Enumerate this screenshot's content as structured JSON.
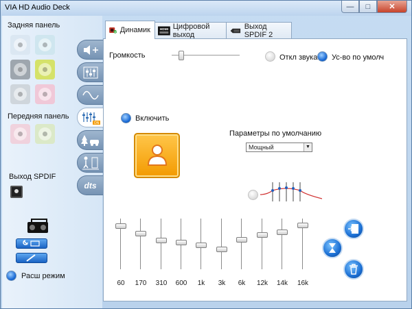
{
  "window": {
    "title": "VIA HD Audio Deck"
  },
  "colors": {
    "accent": "#1869d6",
    "orange": "#f39a00",
    "window_bg": "#c6dcf2",
    "pink_jack": "#f0c8d8",
    "lime_jack": "#d5e26a"
  },
  "left": {
    "rear_panel_label": "Задняя панель",
    "front_panel_label": "Передняя панель",
    "spdif_label": "Выход SPDIF",
    "extended_mode_label": "Расш режим",
    "rear_jacks": [
      "blue-light",
      "teal-light",
      "grey",
      "lime",
      "grey-light",
      "pink-light"
    ],
    "front_jacks": [
      "pink-light",
      "lime-light"
    ],
    "side_tabs": [
      "speaker-volume-icon",
      "mixer-icon",
      "waveform-icon",
      "equalizer-icon",
      "environment-icon",
      "room-correction-icon",
      "dts-icon"
    ],
    "side_tab_dts_text": "dts",
    "side_tab_eq_badge": "ON"
  },
  "tabs": [
    {
      "label": "Динамик",
      "icon": "speaker-icon"
    },
    {
      "label": "Цифровой выход",
      "icon": "hdmi-icon",
      "badge": "HDMI"
    },
    {
      "label": "Выход SPDIF 2",
      "icon": "spdif-device-icon"
    }
  ],
  "content": {
    "volume_label": "Громкость",
    "volume_level": 0.1,
    "mute_label": "Откл звука",
    "mute_selected": false,
    "default_device_label": "Ус-во по умолч",
    "default_device_selected": true,
    "enable_label": "Включить",
    "enable_selected": true,
    "defaults_label": "Параметры по умолчанию",
    "preset_value": "Мощный",
    "eq_bands": [
      {
        "freq": "60",
        "level": 0.85
      },
      {
        "freq": "170",
        "level": 0.7
      },
      {
        "freq": "310",
        "level": 0.57
      },
      {
        "freq": "600",
        "level": 0.53
      },
      {
        "freq": "1k",
        "level": 0.47
      },
      {
        "freq": "3k",
        "level": 0.39
      },
      {
        "freq": "6k",
        "level": 0.58
      },
      {
        "freq": "12k",
        "level": 0.68
      },
      {
        "freq": "14k",
        "level": 0.73
      },
      {
        "freq": "16k",
        "level": 0.86
      }
    ],
    "round_buttons": [
      "save-preset-icon",
      "reset-eq-icon",
      "delete-preset-icon"
    ]
  }
}
